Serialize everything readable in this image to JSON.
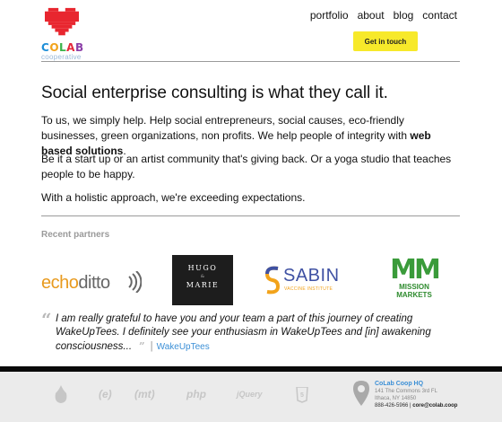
{
  "header": {
    "logo_text": [
      "C",
      "O",
      "L",
      "A",
      "B"
    ],
    "logo_colors": [
      "#1f8fd8",
      "#f2a31b",
      "#3bb34a",
      "#e5283a",
      "#8c3fa8"
    ],
    "logo_sub": "cooperative",
    "nav": [
      "portfolio",
      "about",
      "blog",
      "contact"
    ],
    "cta_label": "Get in touch",
    "cta_color": "#f7e92a",
    "heart_color": "#e8262f"
  },
  "main": {
    "headline": "Social enterprise consulting is what they call it.",
    "p1_start": "To us, we simply help. Help social entrepreneurs, social causes, eco-friendly businesses, green organizations, non profits. We help people of integrity with ",
    "p1_bold": "web based solutions",
    "p1_end": ".",
    "p2": "Be it a start up or an artist community that's giving back. Or a yoga studio that teaches people to be happy.",
    "p3": "With a holistic approach, we're exceeding expectations."
  },
  "partners": {
    "title": "Recent partners",
    "echo": {
      "part1": "echo",
      "part2": "ditto"
    },
    "hugo": {
      "line1": "HUGO",
      "amp": "&",
      "line2": "MARIE"
    },
    "sabin": {
      "name": "SABIN",
      "sub": "VACCINE INSTITUTE"
    },
    "mission": {
      "mark": "MM",
      "line1": "MISSION",
      "line2": "MARKETS"
    }
  },
  "testimonial": {
    "text": "I am really grateful to have you and your team a part of this journey of creating WakeUpTees. I definitely see your enthusiasm in WakeUpTees and [in] awakening consciousness...",
    "author": "WakeUpTees"
  },
  "footer": {
    "tech": [
      "(e)",
      "(mt)",
      "php",
      "jQuery"
    ],
    "hq_name": "CoLab Coop HQ",
    "address1": "141 The Commons 3rd FL",
    "address2": "Ithaca, NY 14850",
    "phone": "888-426-5966",
    "email": "core@colab.coop"
  }
}
